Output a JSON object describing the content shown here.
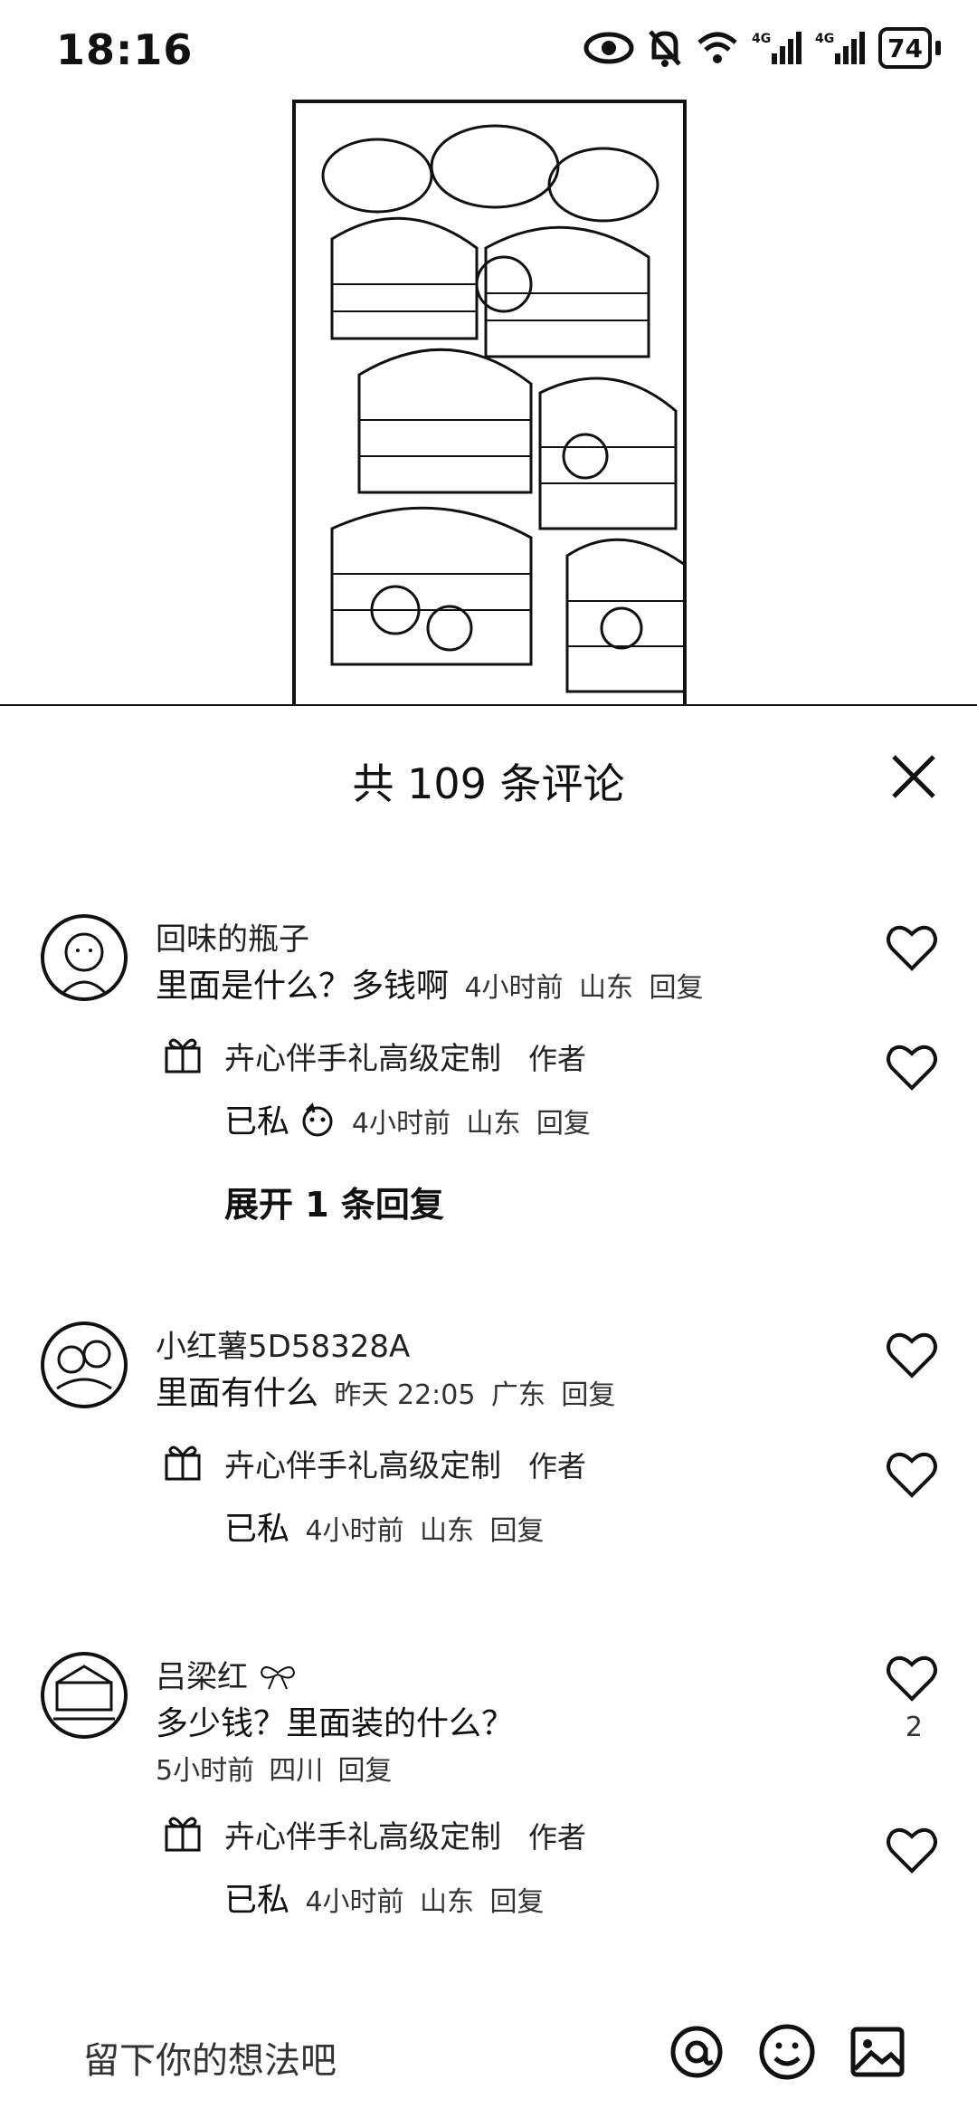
{
  "status": {
    "time": "18:16",
    "battery": "74"
  },
  "sheet": {
    "title": "共 109 条评论",
    "input_placeholder": "留下你的想法吧"
  },
  "comments": [
    {
      "user": "回味的瓶子",
      "text": "里面是什么？多钱啊",
      "time": "4小时前",
      "location": "山东",
      "reply_label": "回复",
      "reply": {
        "user": "卉心伴手礼高级定制",
        "tag": "作者",
        "text": "已私",
        "time": "4小时前",
        "location": "山东",
        "reply_label": "回复"
      },
      "expand": "展开 1 条回复"
    },
    {
      "user": "小红薯5D58328A",
      "text": "里面有什么",
      "time": "昨天 22:05",
      "location": "广东",
      "reply_label": "回复",
      "reply": {
        "user": "卉心伴手礼高级定制",
        "tag": "作者",
        "text": "已私",
        "time": "4小时前",
        "location": "山东",
        "reply_label": "回复"
      }
    },
    {
      "user": "吕梁红",
      "text": "多少钱？里面装的什么？",
      "time": "5小时前",
      "location": "四川",
      "reply_label": "回复",
      "likes": "2",
      "reply": {
        "user": "卉心伴手礼高级定制",
        "tag": "作者",
        "text": "已私",
        "time": "4小时前",
        "location": "山东",
        "reply_label": "回复"
      }
    }
  ],
  "icons": {
    "status": [
      "eye-icon",
      "bell-off-icon",
      "wifi-icon",
      "signal-4g-icon",
      "signal-4g-icon",
      "battery-icon"
    ],
    "close": "close-icon",
    "like": "heart-icon",
    "input_bar": [
      "at-icon",
      "emoji-icon",
      "image-icon"
    ]
  }
}
